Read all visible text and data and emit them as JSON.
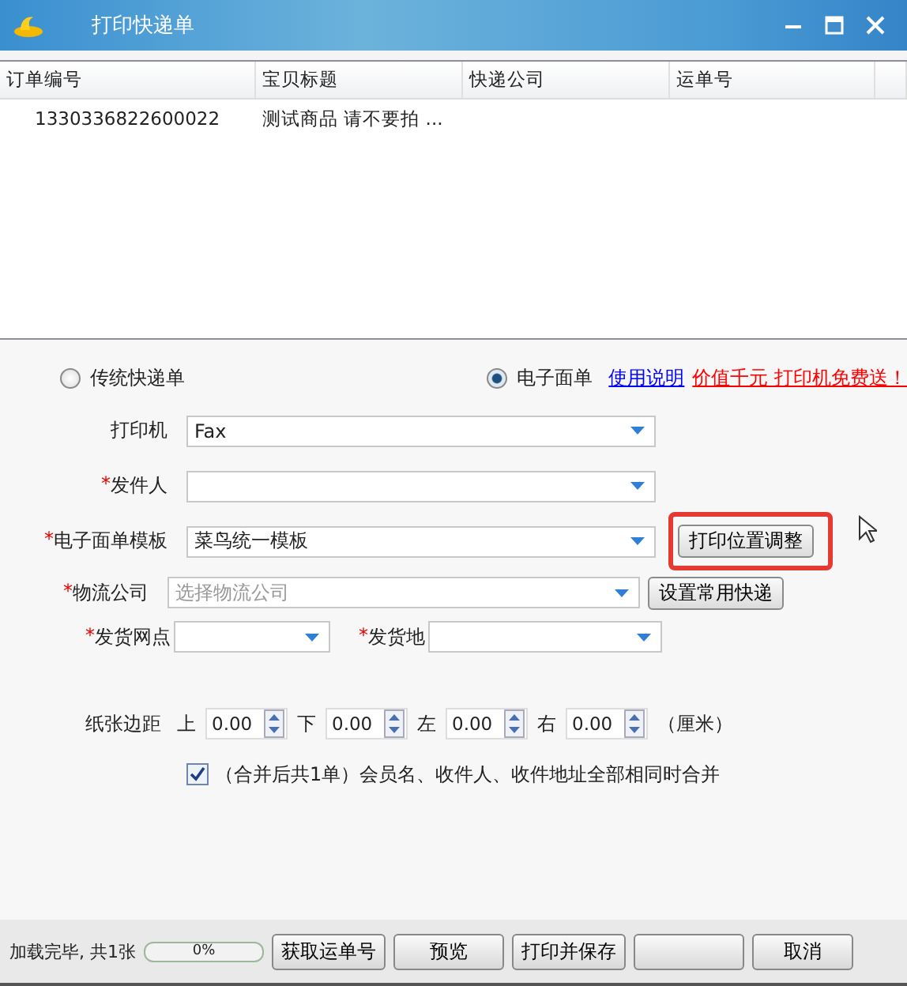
{
  "window": {
    "title": "打印快递单"
  },
  "table": {
    "columns": [
      "订单编号",
      "宝贝标题",
      "快递公司",
      "运单号"
    ],
    "rows": [
      {
        "cells": [
          "1330336822600022",
          "测试商品  请不要拍 ..."
        ],
        "selected": false
      }
    ]
  },
  "mode": [
    {
      "label": "传统快递单",
      "selected": false
    },
    {
      "label": "电子面单",
      "selected": true
    }
  ],
  "links": [
    {
      "text": "使用说明",
      "kind": "help"
    },
    {
      "text": "价值千元 打印机免费送！",
      "kind": "promo"
    }
  ],
  "fields": [
    {
      "label": "打印机",
      "value": "Fax"
    },
    {
      "mark": "*",
      "label": "发件人"
    },
    {
      "mark": "*",
      "label": "电子面单模板",
      "value": "菜鸟统一模板",
      "button": {
        "label": "打印位置调整",
        "highlighted": true
      }
    },
    {
      "mark": "*",
      "label": "物流公司",
      "placeholder": "选择物流公司",
      "button": {
        "label": "设置常用快递",
        "highlighted": false
      }
    }
  ],
  "dispatch": [
    {
      "mark": "*",
      "label": "发货网点"
    },
    {
      "mark": "*",
      "label": "发货地"
    }
  ],
  "margins": {
    "label": "纸张边距",
    "unit": "（厘米）",
    "sides": [
      {
        "label": "上",
        "value": "0.00"
      },
      {
        "label": "下",
        "value": "0.00"
      },
      {
        "label": "左",
        "value": "0.00"
      },
      {
        "label": "右",
        "value": "0.00"
      }
    ]
  },
  "merge": {
    "label": "（合并后共1单）会员名、收件人、收件地址全部相同时合并",
    "checked": true
  },
  "status_bar": {
    "text": "加载完毕, 共1张",
    "progress_text": "0%",
    "level": 0,
    "buttons": [
      {
        "kind": "action",
        "label": "获取运单号"
      },
      {
        "kind": "action",
        "label": "预览"
      },
      {
        "kind": "action",
        "label": "打印并保存"
      },
      {
        "kind": "blank"
      },
      {
        "kind": "action",
        "label": "取消"
      }
    ]
  }
}
